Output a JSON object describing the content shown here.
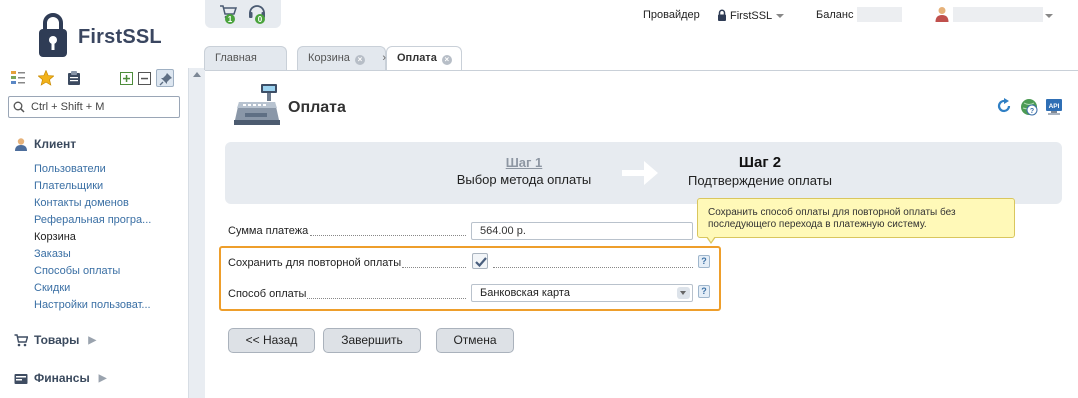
{
  "brand": {
    "name": "FirstSSL"
  },
  "header": {
    "notif_cart_count": "1",
    "notif_support_count": "0",
    "provider_label": "Провайдер",
    "provider_value": "FirstSSL",
    "balance_label": "Баланс"
  },
  "sidebar": {
    "search_placeholder": "Ctrl + Shift + M",
    "client_title": "Клиент",
    "client_items": [
      "Пользователи",
      "Плательщики",
      "Контакты доменов",
      "Реферальная програ...",
      "Корзина",
      "Заказы",
      "Способы оплаты",
      "Скидки",
      "Настройки пользоват..."
    ],
    "goods_title": "Товары",
    "finance_title": "Финансы"
  },
  "tabs": [
    "Главная",
    "Корзина",
    "Оплата"
  ],
  "page": {
    "title": "Оплата",
    "step1_title": "Шаг 1",
    "step1_sub": "Выбор метода оплаты",
    "step2_title": "Шаг 2",
    "step2_sub": "Подтверждение оплаты",
    "tooltip": "Сохранить способ оплаты для повторной оплаты без последующего перехода в платежную систему.",
    "amount_label": "Сумма платежа",
    "amount_value": "564.00 р.",
    "save_label": "Сохранить для повторной оплаты",
    "save_checked": true,
    "method_label": "Способ оплаты",
    "method_value": "Банковская карта",
    "help_mark": "?"
  },
  "buttons": {
    "back": "<< Назад",
    "finish": "Завершить",
    "cancel": "Отмена"
  }
}
